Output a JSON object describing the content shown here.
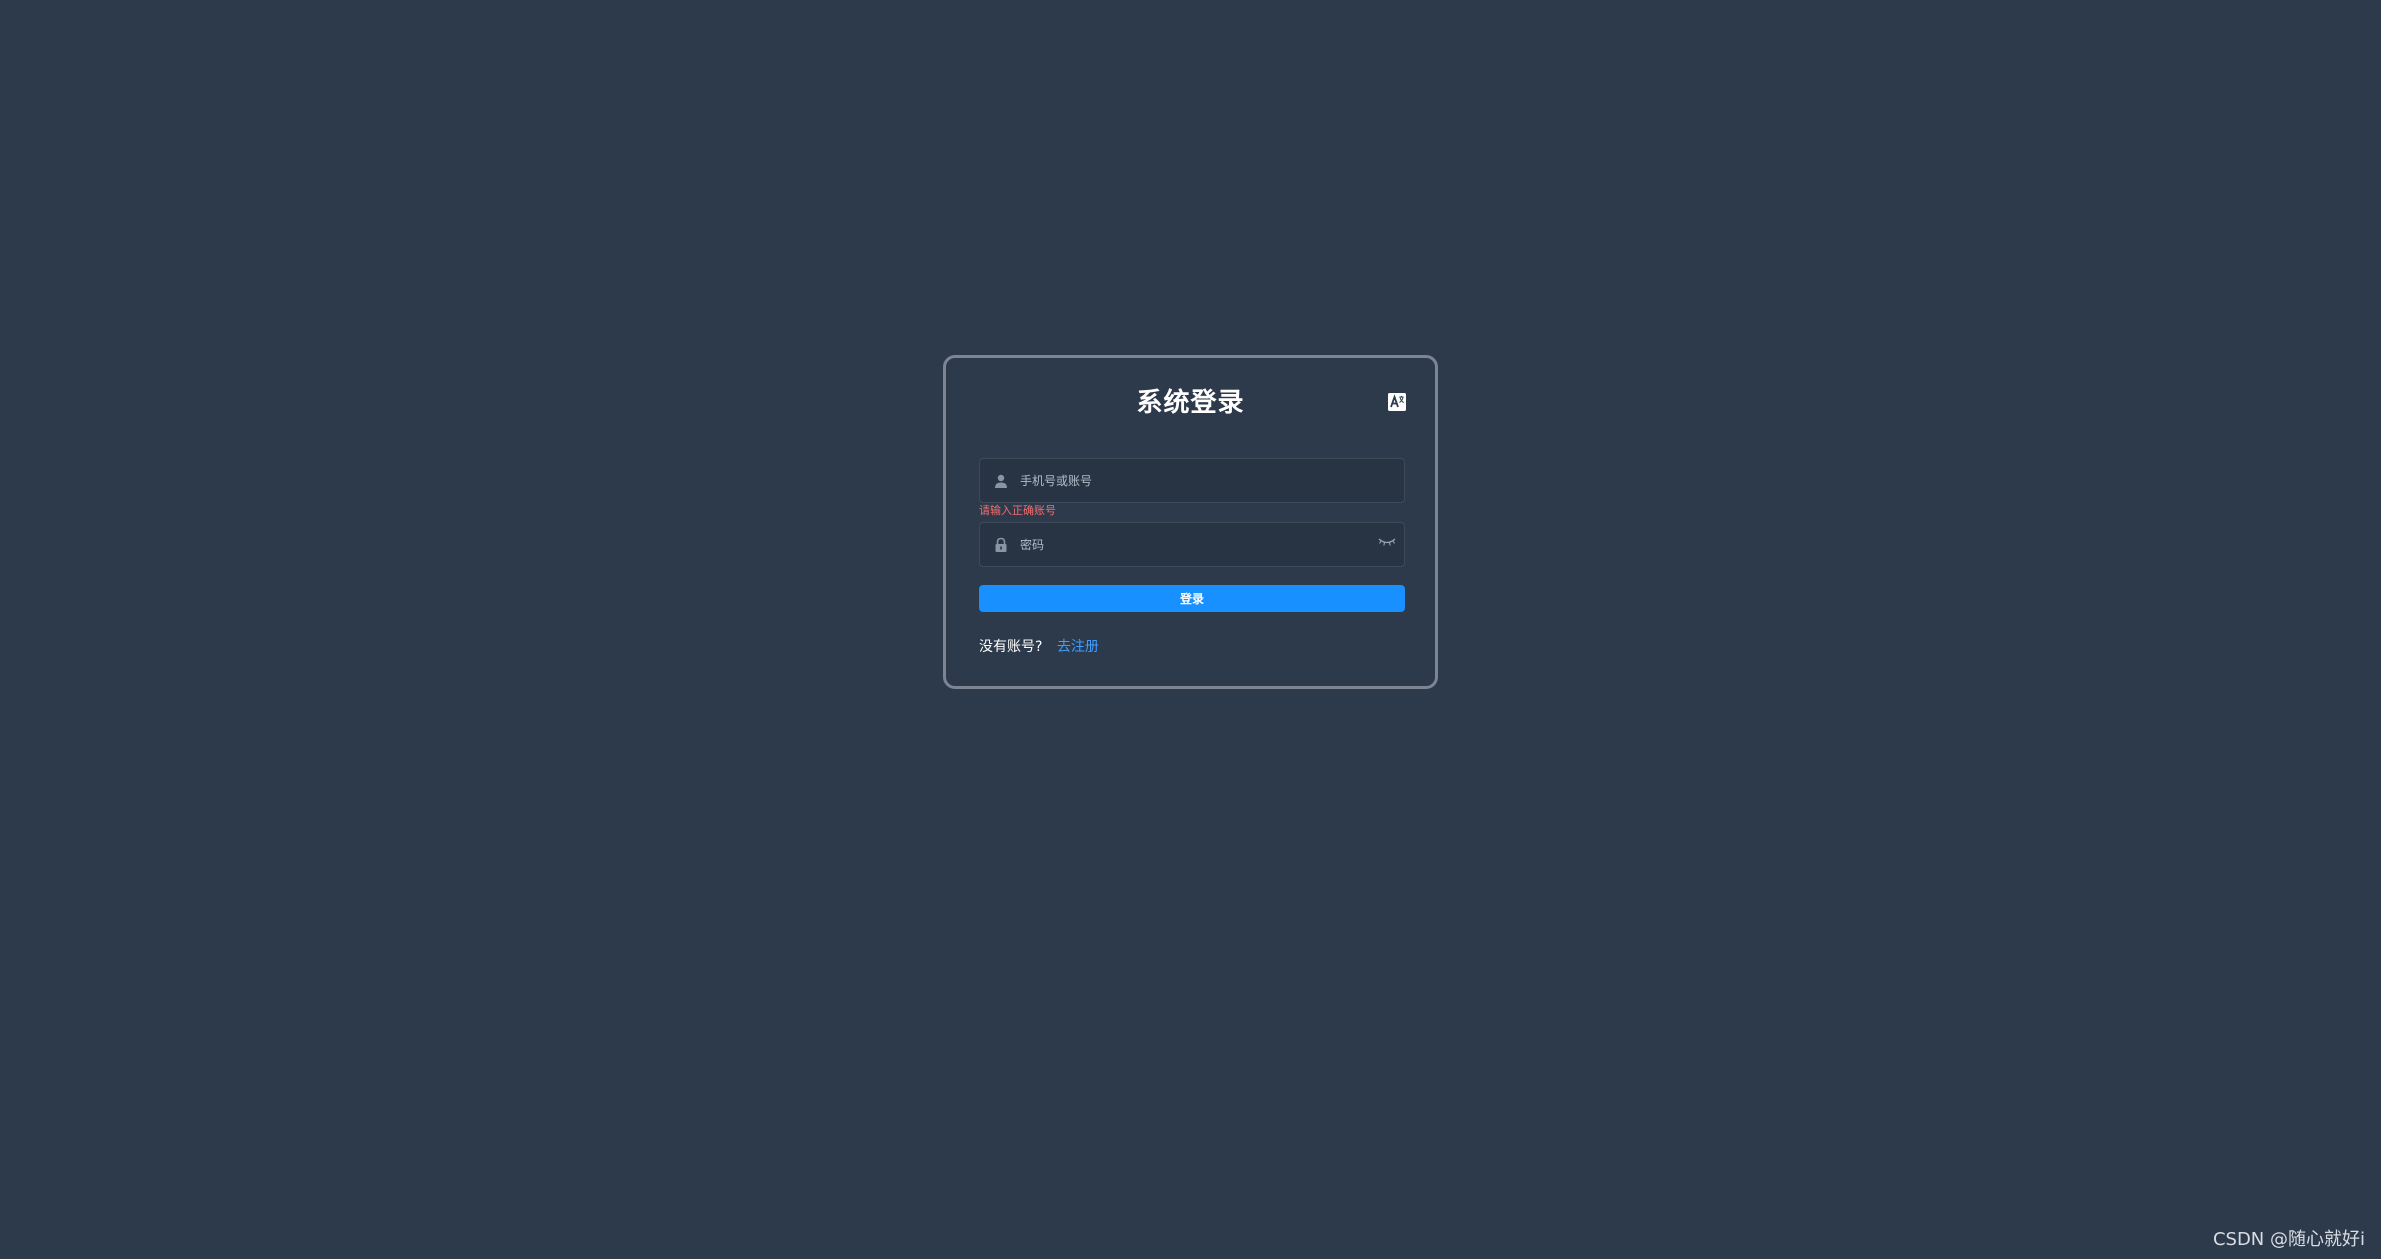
{
  "login": {
    "title": "系统登录",
    "language_icon": "translate-icon",
    "account": {
      "placeholder": "手机号或账号",
      "value": "",
      "icon": "user-icon",
      "error": "请输入正确账号"
    },
    "password": {
      "placeholder": "密码",
      "value": "",
      "icon": "lock-icon",
      "toggle_icon": "eye-closed-icon"
    },
    "submit_label": "登录",
    "no_account_text": "没有账号?",
    "register_link": "去注册"
  },
  "watermark": "CSDN @随心就好i",
  "colors": {
    "background": "#2d3a4b",
    "input_background": "#283443",
    "primary": "#1890ff",
    "link": "#409eff",
    "error": "#f56c6c"
  }
}
